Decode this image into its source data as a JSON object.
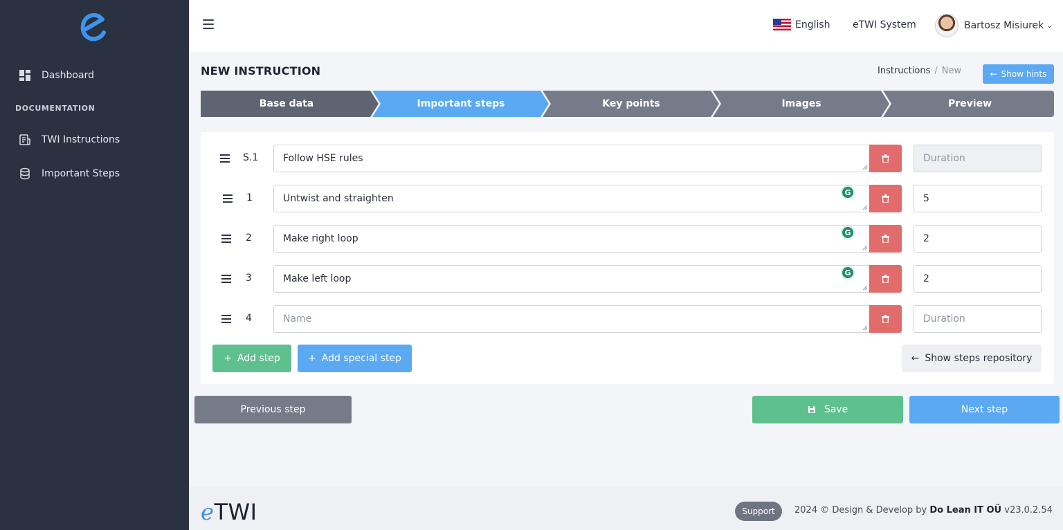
{
  "sidebar": {
    "items": [
      {
        "label": "Dashboard",
        "icon": "dashboard-icon"
      },
      {
        "label": "TWI Instructions",
        "icon": "document-icon"
      },
      {
        "label": "Important Steps",
        "icon": "database-icon"
      }
    ],
    "section_label": "DOCUMENTATION"
  },
  "topbar": {
    "language": "English",
    "system": "eTWI System",
    "user_name": "Bartosz Misiurek"
  },
  "page": {
    "title": "NEW INSTRUCTION",
    "breadcrumb": [
      "Instructions",
      "New"
    ],
    "show_hints": "Show hints"
  },
  "wizard": {
    "steps": [
      "Base data",
      "Important steps",
      "Key points",
      "Images",
      "Preview"
    ],
    "active_index": 1
  },
  "rows": [
    {
      "number": "S.1",
      "name": "Follow HSE rules",
      "duration": "",
      "duration_placeholder": "Duration",
      "grammarly": false,
      "special": true
    },
    {
      "number": "1",
      "name": "Untwist and straighten",
      "duration": "5",
      "duration_placeholder": "Duration",
      "grammarly": true
    },
    {
      "number": "2",
      "name": "Make right loop",
      "duration": "2",
      "duration_placeholder": "Duration",
      "grammarly": true
    },
    {
      "number": "3",
      "name": "Make left loop",
      "duration": "2",
      "duration_placeholder": "Duration",
      "grammarly": true
    },
    {
      "number": "4",
      "name": "",
      "name_placeholder": "Name",
      "duration": "",
      "duration_placeholder": "Duration",
      "grammarly": false
    }
  ],
  "actions": {
    "add_step": "Add step",
    "add_special_step": "Add special step",
    "show_repository": "Show steps repository",
    "previous": "Previous step",
    "save": "Save",
    "next": "Next step"
  },
  "footer": {
    "logo_e": "e",
    "logo_rest": "TWI",
    "support": "Support",
    "copyright_prefix": "2024 © Design & Develop by",
    "company": "Do Lean IT OÜ",
    "version": "v23.0.2.54"
  },
  "colors": {
    "sidebar": "#2a3140",
    "accent_blue": "#5aa9f2",
    "green": "#5fc08f",
    "red": "#e26b6b",
    "stepper_dark": "#5f6473",
    "stepper_grey": "#767b8a"
  }
}
